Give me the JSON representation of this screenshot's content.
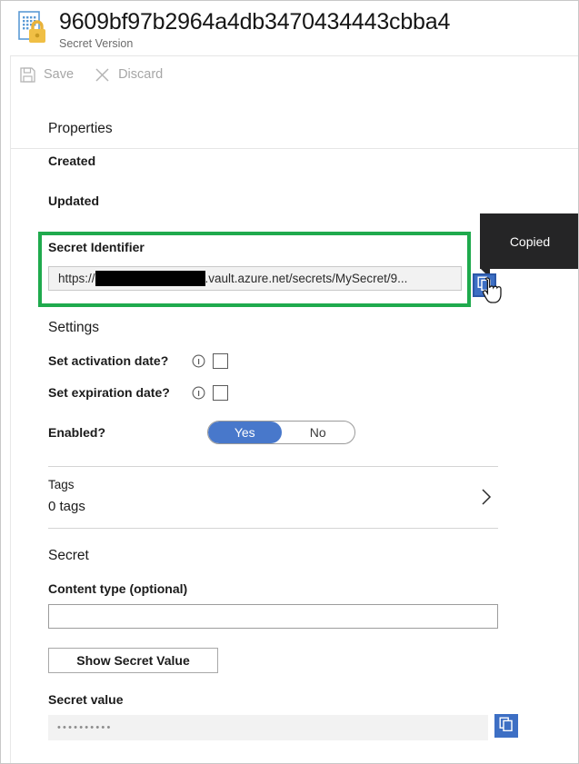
{
  "header": {
    "title": "9609bf97b2964a4db3470434443cbba4",
    "subtitle": "Secret Version",
    "icon": "key-vault-secret-icon"
  },
  "commandbar": {
    "save_label": "Save",
    "save_icon": "save-floppy-icon",
    "discard_label": "Discard",
    "discard_icon": "close-x-icon"
  },
  "properties": {
    "heading": "Properties",
    "created_label": "Created",
    "created_value": "",
    "updated_label": "Updated",
    "updated_value": ""
  },
  "secret_identifier": {
    "label": "Secret Identifier",
    "value_prefix": "https://",
    "value_suffix": ".vault.azure.net/secrets/MySecret/9...",
    "redacted": true,
    "copy_icon": "copy-icon",
    "highlight_color": "#1faa4d",
    "tooltip": "Copied",
    "cursor": "pointer-hand-cursor"
  },
  "settings": {
    "heading": "Settings",
    "rows": [
      {
        "label": "Set activation date?",
        "info_icon": "info-icon",
        "checked": false
      },
      {
        "label": "Set expiration date?",
        "info_icon": "info-icon",
        "checked": false
      }
    ],
    "enabled": {
      "label": "Enabled?",
      "yes_label": "Yes",
      "no_label": "No",
      "selected": "Yes",
      "accent_color": "#4878cb"
    }
  },
  "tags": {
    "title": "Tags",
    "count_label": "0 tags",
    "chevron_icon": "chevron-right-icon"
  },
  "secret": {
    "heading": "Secret",
    "content_type_label": "Content type (optional)",
    "content_type_value": "",
    "content_type_placeholder": "",
    "show_button_label": "Show Secret Value"
  },
  "secret_value": {
    "label": "Secret value",
    "masked_value": "••••••••••",
    "copy_icon": "copy-icon",
    "copy_button_color": "#3d6fc4"
  }
}
